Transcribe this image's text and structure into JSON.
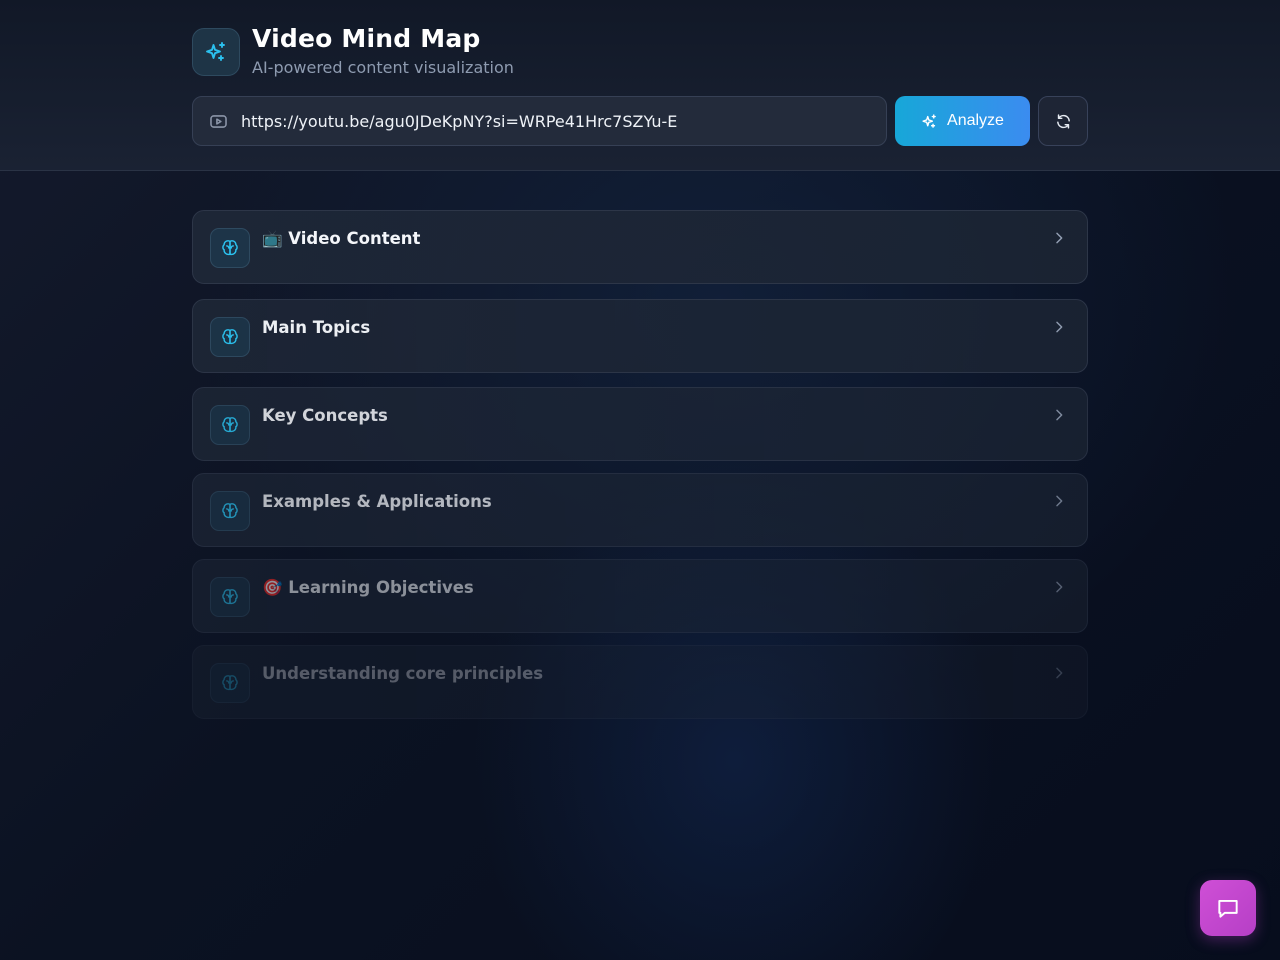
{
  "header": {
    "title": "Video Mind Map",
    "subtitle": "AI-powered content visualization",
    "logo_icon": "sparkles-icon",
    "url_input": {
      "value": "https://youtu.be/agu0JDeKpNY?si=WRPe41Hrc7SZYu-E",
      "icon": "youtube-icon"
    },
    "analyze_label": "Analyze",
    "refresh_icon": "refresh-icon"
  },
  "mind_map": {
    "nodes": [
      {
        "label": "📺 Video Content",
        "icon": "brain-icon"
      },
      {
        "label": "Main Topics",
        "icon": "brain-icon"
      },
      {
        "label": "Key Concepts",
        "icon": "brain-icon"
      },
      {
        "label": "Examples & Applications",
        "icon": "brain-icon"
      },
      {
        "label": "🎯 Learning Objectives",
        "icon": "brain-icon"
      },
      {
        "label": "Understanding core principles",
        "icon": "brain-icon"
      }
    ]
  },
  "chat": {
    "icon": "chat-icon"
  },
  "colors": {
    "accent": "#22b8e6",
    "analyze_gradient_start": "#17a7d8",
    "analyze_gradient_end": "#3b8cf0",
    "chat_button": "#c848d2",
    "background": "#0b1222"
  }
}
